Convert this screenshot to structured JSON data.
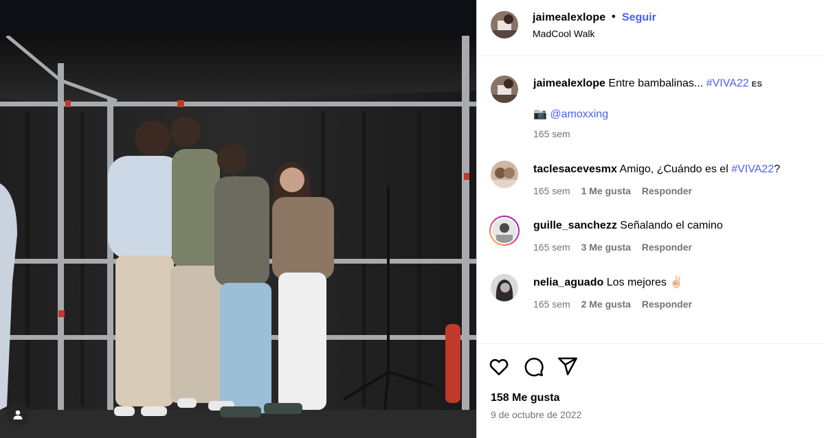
{
  "header": {
    "username": "jaimealexlope",
    "separator": "•",
    "follow_label": "Seguir",
    "location": "MadCool Walk"
  },
  "caption": {
    "username": "jaimealexlope",
    "text": "Entre bambalinas...",
    "hashtag": "#VIVA22",
    "flag_label": "ES",
    "camera_emoji": "📷",
    "mention": "@amoxxing",
    "time": "165 sem"
  },
  "comments": [
    {
      "username": "taclesaceves mx",
      "text": "Amigo, ¿Cuándo es el",
      "hashtag": "#VIVA22",
      "suffix": "?",
      "time": "165 sem",
      "likes": "1 Me gusta",
      "reply": "Responder"
    },
    {
      "username": "guille_sanchezz",
      "text": "Señalando el camino",
      "time": "165 sem",
      "likes": "3 Me gusta",
      "reply": "Responder"
    },
    {
      "username": "nelia_aguado",
      "text": "Los mejores ✌🏻",
      "time": "165 sem",
      "likes": "2 Me gusta",
      "reply": "Responder"
    }
  ],
  "actions": {
    "like_icon": "heart-icon",
    "comment_icon": "comment-icon",
    "share_icon": "share-icon"
  },
  "footer": {
    "likes": "158 Me gusta",
    "date": "9 de octubre de 2022"
  },
  "media": {
    "user_tag_icon": "person-icon"
  },
  "colors": {
    "accent": "#4a5df9",
    "muted": "#737373",
    "media_bg": "#0c1014"
  }
}
